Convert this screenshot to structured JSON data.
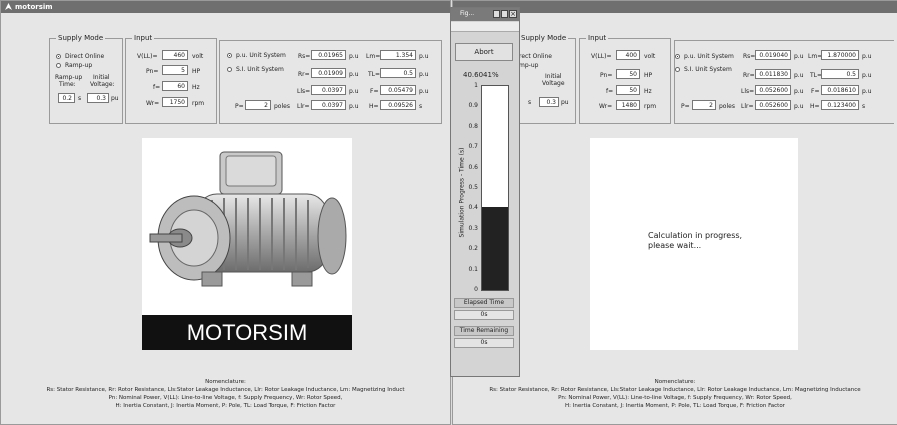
{
  "left_window": {
    "title": "motorsim",
    "supply_mode": {
      "legend": "Supply Mode",
      "option_direct": "Direct Online",
      "option_rampup": "Ramp-up",
      "rampup_time_label_1": "Ramp-up",
      "rampup_time_label_2": "Time:",
      "initial_voltage_label_1": "Initial",
      "initial_voltage_label_2": "Voltage:",
      "rampup_time_value": "0.2",
      "rampup_time_unit": "s",
      "initial_voltage_value": "0.3",
      "initial_voltage_unit": "pu"
    },
    "input": {
      "legend": "Input",
      "vll_label": "V(LL)=",
      "vll_value": "460",
      "vll_unit": "volt",
      "pn_label": "Pn=",
      "pn_value": "5",
      "pn_unit": "HP",
      "f_label": "f=",
      "f_value": "60",
      "f_unit": "Hz",
      "wr_label": "Wr=",
      "wr_value": "1750",
      "wr_unit": "rpm"
    },
    "params": {
      "radio_pu": "p.u. Unit System",
      "radio_si": "S.I. Unit System",
      "rs_label": "Rs=",
      "rs_value": "0.01965",
      "rs_unit": "p.u",
      "rr_label": "Rr=",
      "rr_value": "0.01909",
      "rr_unit": "p.u",
      "lls_label": "Lls=",
      "lls_value": "0.0397",
      "lls_unit": "p.u",
      "llr_label": "Llr=",
      "llr_value": "0.0397",
      "llr_unit": "p.u",
      "p_label": "P=",
      "p_value": "2",
      "p_unit": "poles",
      "lm_label": "Lm=",
      "lm_value": "1.354",
      "lm_unit": "p.u",
      "tl_label": "TL=",
      "tl_value": "0.5",
      "tl_unit": "p.u",
      "ff_label": "F=",
      "ff_value": "0.05479",
      "ff_unit": "p.u",
      "h_label": "H=",
      "h_value": "0.09526",
      "h_unit": "s"
    },
    "banner": "MOTORSIM",
    "nomenclature_title": "Nomenclature:",
    "nomenclature_line1": "Rs: Stator Resistance, Rr: Rotor Resistance, Lls:Stator Leakage Inductance, Llr: Rotor Leakage Inductance, Lm: Magnetizing Induct",
    "nomenclature_line2": "Pn: Nominal Power, V(LL): Line-to-line Voltage, f: Supply Frequency, Wr: Rotor Speed,",
    "nomenclature_line3": "H: Inertia Constant, J: Inertia Moment, P: Pole, TL: Load Torque, F: Friction Factor"
  },
  "progress_window": {
    "title": "Fig...",
    "abort_label": "Abort",
    "percent_text": "40.6041%",
    "progress_fraction": 0.406,
    "axis_label": "Simulation Progress - Time (s)",
    "ticks": [
      "1",
      "0.9",
      "0.8",
      "0.7",
      "0.6",
      "0.5",
      "0.4",
      "0.3",
      "0.2",
      "0.1",
      "0"
    ],
    "elapsed_label": "Elapsed Time",
    "elapsed_value": "0s",
    "remaining_label": "Time Remaining",
    "remaining_value": "0s"
  },
  "right_window": {
    "supply_legend": "Supply Mode",
    "option_direct": "rect Online",
    "option_rampup": "mp-up",
    "initial_voltage_label_1": "Initial",
    "initial_voltage_label_2": "Voltage",
    "rampup_unit": "s",
    "initial_voltage_value": "0.3",
    "initial_voltage_unit": "pu",
    "input_legend": "Input",
    "vll_label": "V(LL)=",
    "vll_value": "400",
    "vll_unit": "volt",
    "pn_label": "Pn=",
    "pn_value": "50",
    "pn_unit": "HP",
    "f_label": "f=",
    "f_value": "50",
    "f_unit": "Hz",
    "wr_label": "Wr=",
    "wr_value": "1480",
    "wr_unit": "rpm",
    "radio_pu": "p.u. Unit System",
    "radio_si": "S.I. Unit System",
    "rs_label": "Rs=",
    "rs_value": "0.019040",
    "rs_unit": "p.u",
    "rr_label": "Rr=",
    "rr_value": "0.011830",
    "rr_unit": "p.u",
    "lls_label": "Lls=",
    "lls_value": "0.052600",
    "lls_unit": "p.u",
    "llr_label": "Llr=",
    "llr_value": "0.052600",
    "llr_unit": "p.u",
    "p_label": "P=",
    "p_value": "2",
    "p_unit": "poles",
    "lm_label": "Lm=",
    "lm_value": "1.870000",
    "lm_unit": "p.u",
    "tl_label": "TL=",
    "tl_value": "0.5",
    "tl_unit": "p.u",
    "ff_label": "F=",
    "ff_value": "0.018610",
    "ff_unit": "p.u",
    "h_label": "H=",
    "h_value": "0.123400",
    "h_unit": "s",
    "calc_line1": "Calculation in progress,",
    "calc_line2": "please wait...",
    "nomenclature_title": "Nomenclature:",
    "nomenclature_line1": "Rs: Stator Resistance, Rr: Rotor Resistance, Lls:Stator Leakage Inductance, Llr: Rotor Leakage Inductance, Lm: Magnetizing Inductance",
    "nomenclature_line2": "Pn: Nominal Power, V(LL): Line-to-line Voltage, f: Supply Frequency, Wr: Rotor Speed,",
    "nomenclature_line3": "H: Inertia Constant, J: Inertia Moment, P: Pole, TL: Load Torque, F: Friction Factor"
  }
}
